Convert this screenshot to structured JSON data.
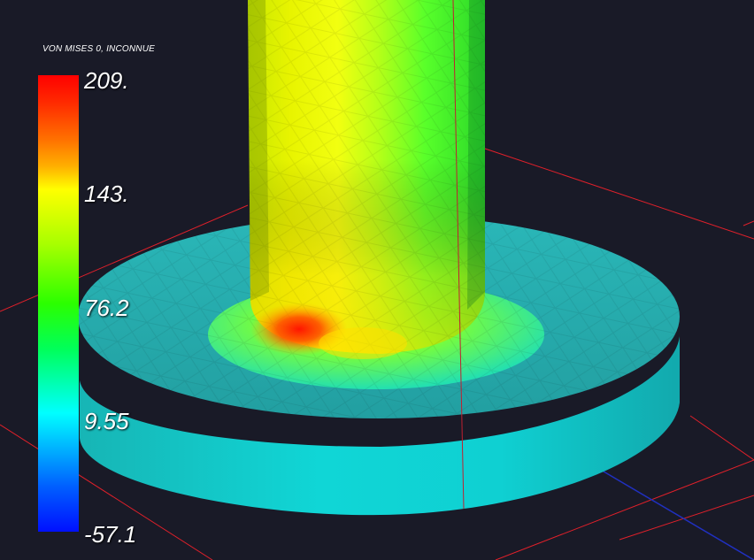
{
  "legend": {
    "title": "VON MISES 0, INCONNUE",
    "ticks": [
      "209.",
      "143.",
      "76.2",
      "9.55",
      "-57.1"
    ],
    "max": 209,
    "min": -57.1
  },
  "colors": {
    "background": "#191a27",
    "max_stress": "#ff0000",
    "mid_stress": "#2bff00",
    "low_stress": "#00ffff",
    "min_stress": "#0010ff",
    "axis_lines": "#e0202a"
  },
  "scene": {
    "object": "fillet-column-on-base-plate",
    "view": "3d-perspective"
  }
}
